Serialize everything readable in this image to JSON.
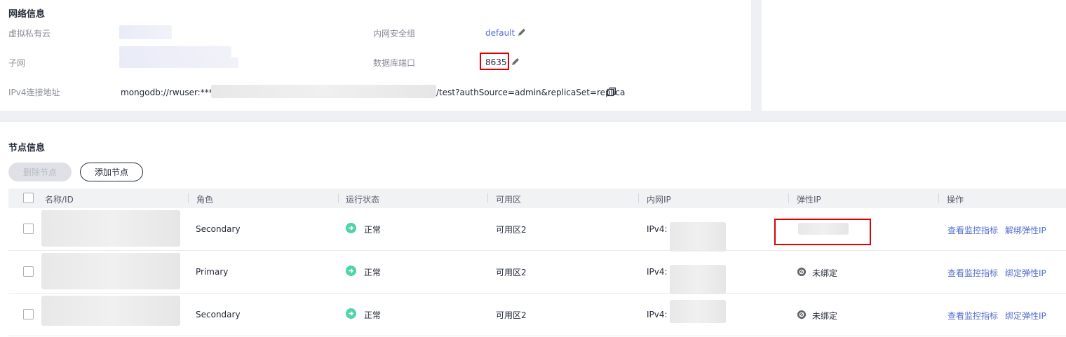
{
  "network": {
    "title": "网络信息",
    "vpc_label": "虚拟私有云",
    "subnet_label": "子网",
    "ipv4_label": "IPv4连接地址",
    "ipv4_prefix": "mongodb://rwuser:****@",
    "ipv4_suffix": "/test?authSource=admin&replicaSet=replica",
    "sg_label": "内网安全组",
    "sg_value": "default",
    "port_label": "数据库端口",
    "port_value": "8635"
  },
  "nodes": {
    "title": "节点信息",
    "delete_label": "删除节点",
    "add_label": "添加节点",
    "columns": [
      "名称/ID",
      "角色",
      "运行状态",
      "可用区",
      "内网IP",
      "弹性IP",
      "操作"
    ],
    "rows": [
      {
        "role": "Secondary",
        "status": "正常",
        "az": "可用区2",
        "ip_prefix": "IPv4:",
        "eip": "",
        "op1": "查看监控指标",
        "op2": "解绑弹性IP"
      },
      {
        "role": "Primary",
        "status": "正常",
        "az": "可用区2",
        "ip_prefix": "IPv4:",
        "eip": "未绑定",
        "op1": "查看监控指标",
        "op2": "绑定弹性IP"
      },
      {
        "role": "Secondary",
        "status": "正常",
        "az": "可用区2",
        "ip_prefix": "IPv4:",
        "eip": "未绑定",
        "op1": "查看监控指标",
        "op2": "绑定弹性IP"
      }
    ]
  },
  "colors": {
    "accent_link": "#526ecc",
    "status_ok": "#50d4ab",
    "highlight": "#e00000"
  },
  "icons": {
    "edit": "pencil-icon",
    "copy": "copy-icon",
    "ok": "check-circle-icon",
    "unbound": "unbound-icon"
  }
}
